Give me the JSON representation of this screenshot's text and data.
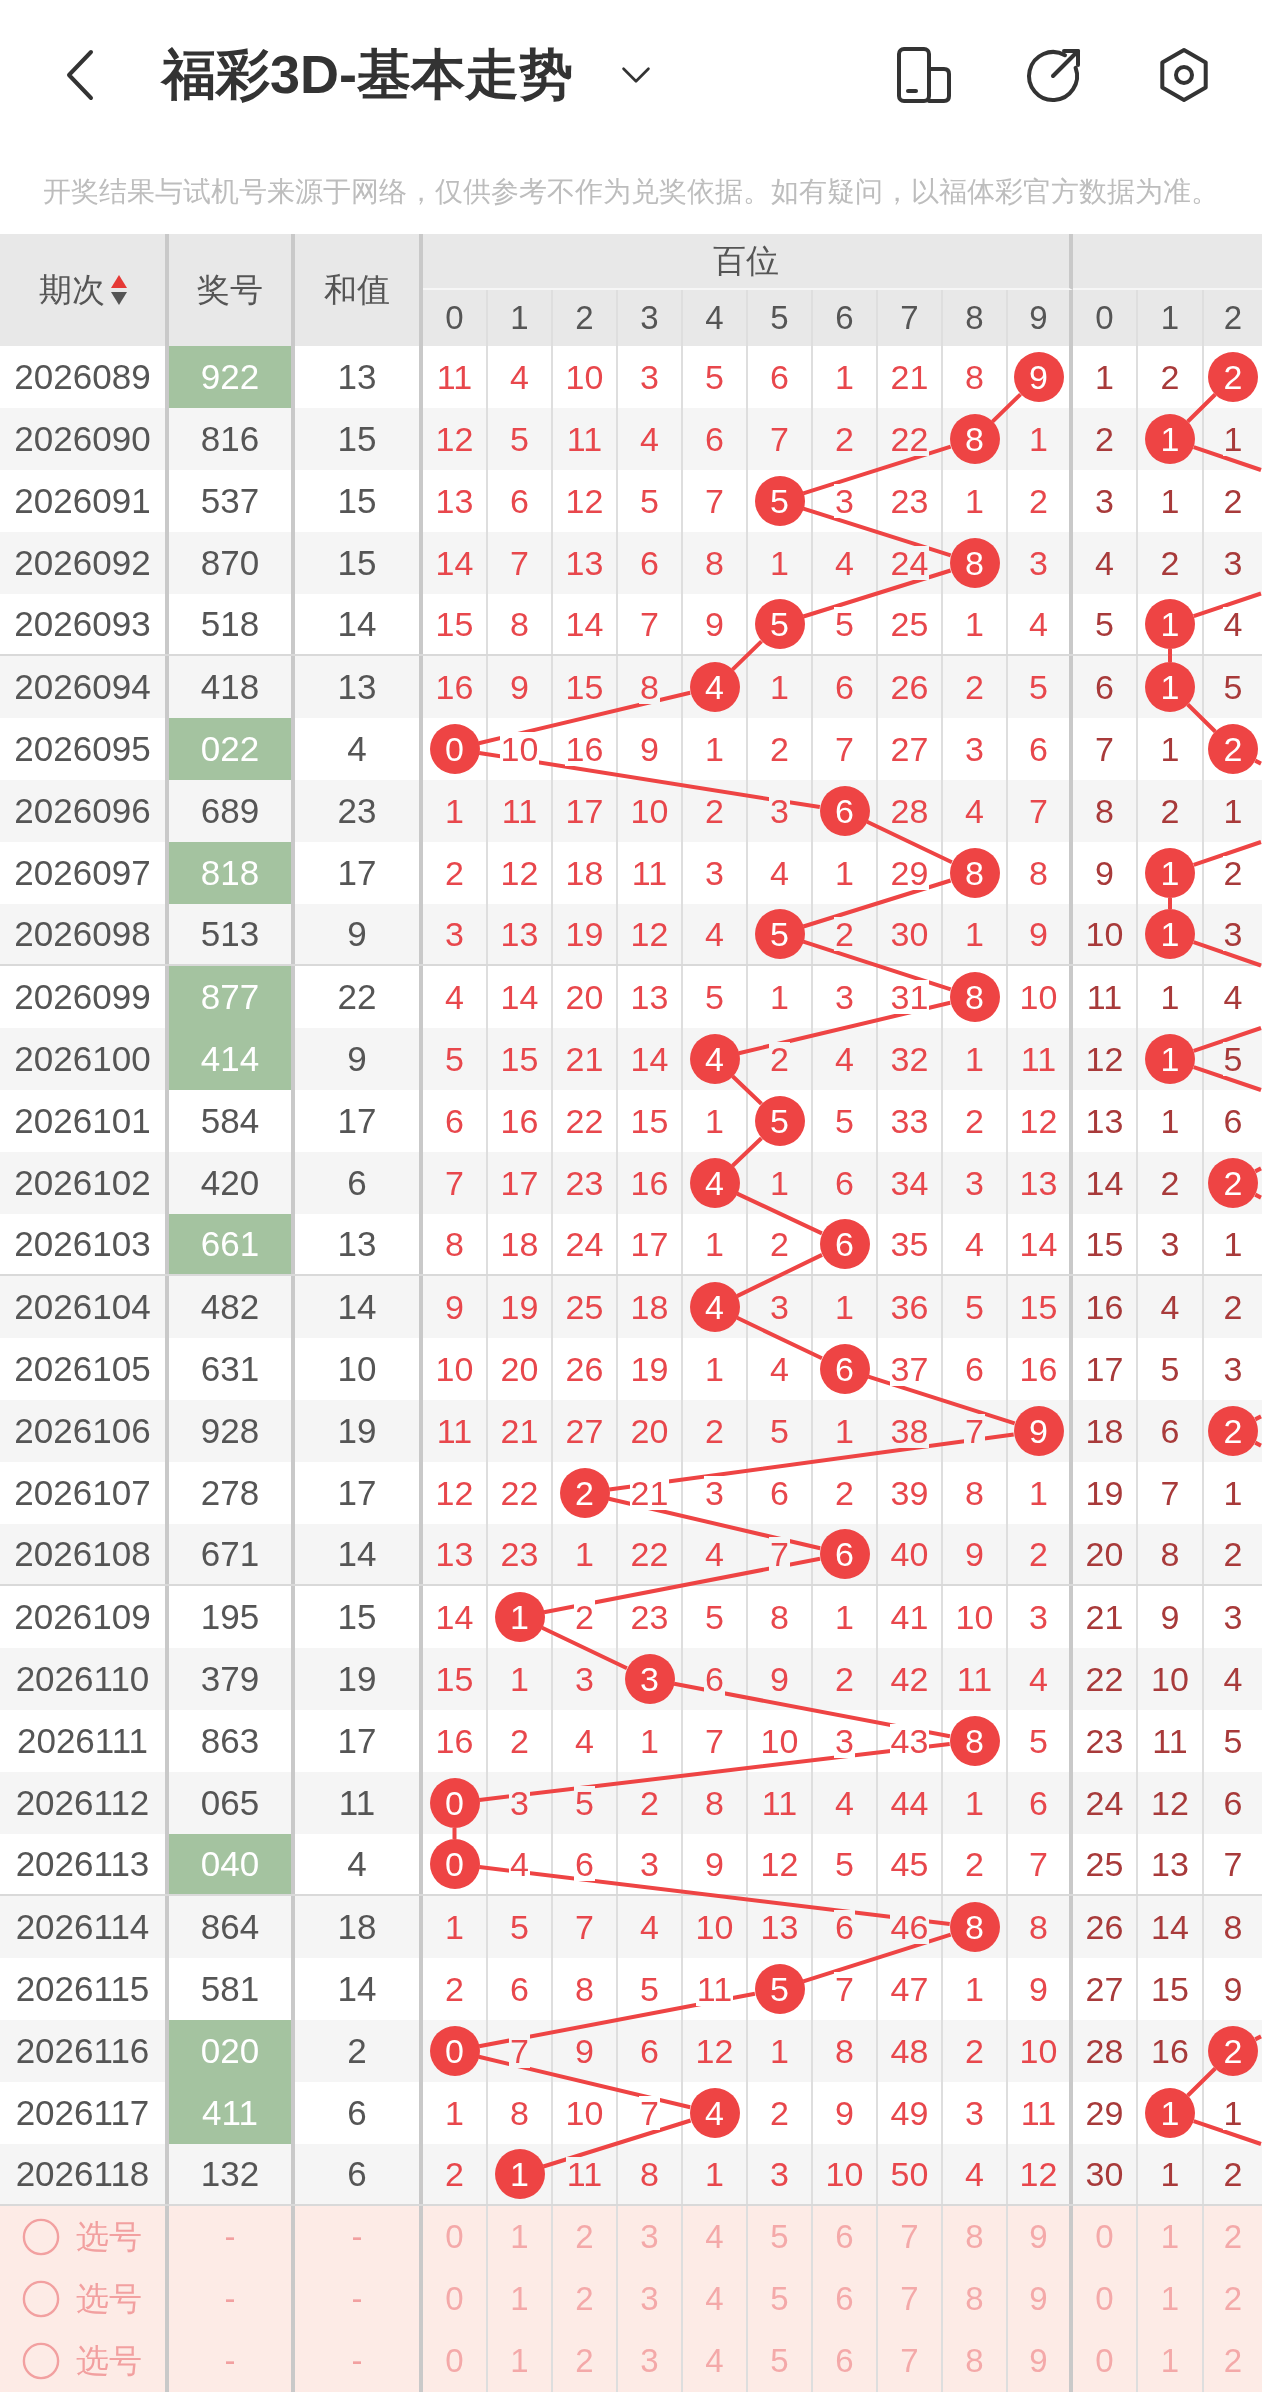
{
  "header": {
    "title": "福彩3D-基本走势"
  },
  "notice": "开奖结果与试机号来源于网络，仅供参考不作为兑奖依据。如有疑问，以福体彩官方数据为准。",
  "table": {
    "columns": [
      {
        "label": "期次",
        "sort_ascending": true
      },
      {
        "label": "奖号"
      },
      {
        "label": "和值"
      }
    ],
    "groups": [
      {
        "label": "百位",
        "digits": [
          "0",
          "1",
          "2",
          "3",
          "4",
          "5",
          "6",
          "7",
          "8",
          "9"
        ]
      },
      {
        "digits": [
          "0",
          "1",
          "2"
        ]
      }
    ],
    "rows": [
      {
        "period": "2026089",
        "number": "922",
        "highlighted": true,
        "sum": "13",
        "hundreds": [
          {
            "text": "11",
            "hit": false
          },
          {
            "text": "4",
            "hit": false
          },
          {
            "text": "10",
            "hit": false
          },
          {
            "text": "3",
            "hit": false
          },
          {
            "text": "5",
            "hit": false
          },
          {
            "text": "6",
            "hit": false
          },
          {
            "text": "1",
            "hit": false
          },
          {
            "text": "21",
            "hit": false
          },
          {
            "text": "8",
            "hit": false
          },
          {
            "text": "9",
            "hit": true
          }
        ],
        "tens": [
          {
            "text": "1",
            "hit": false
          },
          {
            "text": "2",
            "hit": false
          },
          {
            "text": "2",
            "hit": true
          }
        ]
      },
      {
        "period": "2026090",
        "number": "816",
        "highlighted": false,
        "sum": "15",
        "hundreds": [
          {
            "text": "12",
            "hit": false
          },
          {
            "text": "5",
            "hit": false
          },
          {
            "text": "11",
            "hit": false
          },
          {
            "text": "4",
            "hit": false
          },
          {
            "text": "6",
            "hit": false
          },
          {
            "text": "7",
            "hit": false
          },
          {
            "text": "2",
            "hit": false
          },
          {
            "text": "22",
            "hit": false
          },
          {
            "text": "8",
            "hit": true
          },
          {
            "text": "1",
            "hit": false
          }
        ],
        "tens": [
          {
            "text": "2",
            "hit": false
          },
          {
            "text": "1",
            "hit": true
          },
          {
            "text": "1",
            "hit": false
          }
        ]
      },
      {
        "period": "2026091",
        "number": "537",
        "highlighted": false,
        "sum": "15",
        "hundreds": [
          {
            "text": "13",
            "hit": false
          },
          {
            "text": "6",
            "hit": false
          },
          {
            "text": "12",
            "hit": false
          },
          {
            "text": "5",
            "hit": false
          },
          {
            "text": "7",
            "hit": false
          },
          {
            "text": "5",
            "hit": true
          },
          {
            "text": "3",
            "hit": false
          },
          {
            "text": "23",
            "hit": false
          },
          {
            "text": "1",
            "hit": false
          },
          {
            "text": "2",
            "hit": false
          }
        ],
        "tens": [
          {
            "text": "3",
            "hit": false
          },
          {
            "text": "1",
            "hit": false
          },
          {
            "text": "2",
            "hit": false
          }
        ]
      },
      {
        "period": "2026092",
        "number": "870",
        "highlighted": false,
        "sum": "15",
        "hundreds": [
          {
            "text": "14",
            "hit": false
          },
          {
            "text": "7",
            "hit": false
          },
          {
            "text": "13",
            "hit": false
          },
          {
            "text": "6",
            "hit": false
          },
          {
            "text": "8",
            "hit": false
          },
          {
            "text": "1",
            "hit": false
          },
          {
            "text": "4",
            "hit": false
          },
          {
            "text": "24",
            "hit": false
          },
          {
            "text": "8",
            "hit": true
          },
          {
            "text": "3",
            "hit": false
          }
        ],
        "tens": [
          {
            "text": "4",
            "hit": false
          },
          {
            "text": "2",
            "hit": false
          },
          {
            "text": "3",
            "hit": false
          }
        ]
      },
      {
        "period": "2026093",
        "number": "518",
        "highlighted": false,
        "sum": "14",
        "hundreds": [
          {
            "text": "15",
            "hit": false
          },
          {
            "text": "8",
            "hit": false
          },
          {
            "text": "14",
            "hit": false
          },
          {
            "text": "7",
            "hit": false
          },
          {
            "text": "9",
            "hit": false
          },
          {
            "text": "5",
            "hit": true
          },
          {
            "text": "5",
            "hit": false
          },
          {
            "text": "25",
            "hit": false
          },
          {
            "text": "1",
            "hit": false
          },
          {
            "text": "4",
            "hit": false
          }
        ],
        "tens": [
          {
            "text": "5",
            "hit": false
          },
          {
            "text": "1",
            "hit": true
          },
          {
            "text": "4",
            "hit": false
          }
        ]
      },
      {
        "period": "2026094",
        "number": "418",
        "highlighted": false,
        "sum": "13",
        "hundreds": [
          {
            "text": "16",
            "hit": false
          },
          {
            "text": "9",
            "hit": false
          },
          {
            "text": "15",
            "hit": false
          },
          {
            "text": "8",
            "hit": false
          },
          {
            "text": "4",
            "hit": true
          },
          {
            "text": "1",
            "hit": false
          },
          {
            "text": "6",
            "hit": false
          },
          {
            "text": "26",
            "hit": false
          },
          {
            "text": "2",
            "hit": false
          },
          {
            "text": "5",
            "hit": false
          }
        ],
        "tens": [
          {
            "text": "6",
            "hit": false
          },
          {
            "text": "1",
            "hit": true
          },
          {
            "text": "5",
            "hit": false
          }
        ]
      },
      {
        "period": "2026095",
        "number": "022",
        "highlighted": true,
        "sum": "4",
        "hundreds": [
          {
            "text": "0",
            "hit": true
          },
          {
            "text": "10",
            "hit": false
          },
          {
            "text": "16",
            "hit": false
          },
          {
            "text": "9",
            "hit": false
          },
          {
            "text": "1",
            "hit": false
          },
          {
            "text": "2",
            "hit": false
          },
          {
            "text": "7",
            "hit": false
          },
          {
            "text": "27",
            "hit": false
          },
          {
            "text": "3",
            "hit": false
          },
          {
            "text": "6",
            "hit": false
          }
        ],
        "tens": [
          {
            "text": "7",
            "hit": false
          },
          {
            "text": "1",
            "hit": false
          },
          {
            "text": "2",
            "hit": true
          }
        ]
      },
      {
        "period": "2026096",
        "number": "689",
        "highlighted": false,
        "sum": "23",
        "hundreds": [
          {
            "text": "1",
            "hit": false
          },
          {
            "text": "11",
            "hit": false
          },
          {
            "text": "17",
            "hit": false
          },
          {
            "text": "10",
            "hit": false
          },
          {
            "text": "2",
            "hit": false
          },
          {
            "text": "3",
            "hit": false
          },
          {
            "text": "6",
            "hit": true
          },
          {
            "text": "28",
            "hit": false
          },
          {
            "text": "4",
            "hit": false
          },
          {
            "text": "7",
            "hit": false
          }
        ],
        "tens": [
          {
            "text": "8",
            "hit": false
          },
          {
            "text": "2",
            "hit": false
          },
          {
            "text": "1",
            "hit": false
          }
        ]
      },
      {
        "period": "2026097",
        "number": "818",
        "highlighted": true,
        "sum": "17",
        "hundreds": [
          {
            "text": "2",
            "hit": false
          },
          {
            "text": "12",
            "hit": false
          },
          {
            "text": "18",
            "hit": false
          },
          {
            "text": "11",
            "hit": false
          },
          {
            "text": "3",
            "hit": false
          },
          {
            "text": "4",
            "hit": false
          },
          {
            "text": "1",
            "hit": false
          },
          {
            "text": "29",
            "hit": false
          },
          {
            "text": "8",
            "hit": true
          },
          {
            "text": "8",
            "hit": false
          }
        ],
        "tens": [
          {
            "text": "9",
            "hit": false
          },
          {
            "text": "1",
            "hit": true
          },
          {
            "text": "2",
            "hit": false
          }
        ]
      },
      {
        "period": "2026098",
        "number": "513",
        "highlighted": false,
        "sum": "9",
        "hundreds": [
          {
            "text": "3",
            "hit": false
          },
          {
            "text": "13",
            "hit": false
          },
          {
            "text": "19",
            "hit": false
          },
          {
            "text": "12",
            "hit": false
          },
          {
            "text": "4",
            "hit": false
          },
          {
            "text": "5",
            "hit": true
          },
          {
            "text": "2",
            "hit": false
          },
          {
            "text": "30",
            "hit": false
          },
          {
            "text": "1",
            "hit": false
          },
          {
            "text": "9",
            "hit": false
          }
        ],
        "tens": [
          {
            "text": "10",
            "hit": false
          },
          {
            "text": "1",
            "hit": true
          },
          {
            "text": "3",
            "hit": false
          }
        ]
      },
      {
        "period": "2026099",
        "number": "877",
        "highlighted": true,
        "sum": "22",
        "hundreds": [
          {
            "text": "4",
            "hit": false
          },
          {
            "text": "14",
            "hit": false
          },
          {
            "text": "20",
            "hit": false
          },
          {
            "text": "13",
            "hit": false
          },
          {
            "text": "5",
            "hit": false
          },
          {
            "text": "1",
            "hit": false
          },
          {
            "text": "3",
            "hit": false
          },
          {
            "text": "31",
            "hit": false
          },
          {
            "text": "8",
            "hit": true
          },
          {
            "text": "10",
            "hit": false
          }
        ],
        "tens": [
          {
            "text": "11",
            "hit": false
          },
          {
            "text": "1",
            "hit": false
          },
          {
            "text": "4",
            "hit": false
          }
        ]
      },
      {
        "period": "2026100",
        "number": "414",
        "highlighted": true,
        "sum": "9",
        "hundreds": [
          {
            "text": "5",
            "hit": false
          },
          {
            "text": "15",
            "hit": false
          },
          {
            "text": "21",
            "hit": false
          },
          {
            "text": "14",
            "hit": false
          },
          {
            "text": "4",
            "hit": true
          },
          {
            "text": "2",
            "hit": false
          },
          {
            "text": "4",
            "hit": false
          },
          {
            "text": "32",
            "hit": false
          },
          {
            "text": "1",
            "hit": false
          },
          {
            "text": "11",
            "hit": false
          }
        ],
        "tens": [
          {
            "text": "12",
            "hit": false
          },
          {
            "text": "1",
            "hit": true
          },
          {
            "text": "5",
            "hit": false
          }
        ]
      },
      {
        "period": "2026101",
        "number": "584",
        "highlighted": false,
        "sum": "17",
        "hundreds": [
          {
            "text": "6",
            "hit": false
          },
          {
            "text": "16",
            "hit": false
          },
          {
            "text": "22",
            "hit": false
          },
          {
            "text": "15",
            "hit": false
          },
          {
            "text": "1",
            "hit": false
          },
          {
            "text": "5",
            "hit": true
          },
          {
            "text": "5",
            "hit": false
          },
          {
            "text": "33",
            "hit": false
          },
          {
            "text": "2",
            "hit": false
          },
          {
            "text": "12",
            "hit": false
          }
        ],
        "tens": [
          {
            "text": "13",
            "hit": false
          },
          {
            "text": "1",
            "hit": false
          },
          {
            "text": "6",
            "hit": false
          }
        ]
      },
      {
        "period": "2026102",
        "number": "420",
        "highlighted": false,
        "sum": "6",
        "hundreds": [
          {
            "text": "7",
            "hit": false
          },
          {
            "text": "17",
            "hit": false
          },
          {
            "text": "23",
            "hit": false
          },
          {
            "text": "16",
            "hit": false
          },
          {
            "text": "4",
            "hit": true
          },
          {
            "text": "1",
            "hit": false
          },
          {
            "text": "6",
            "hit": false
          },
          {
            "text": "34",
            "hit": false
          },
          {
            "text": "3",
            "hit": false
          },
          {
            "text": "13",
            "hit": false
          }
        ],
        "tens": [
          {
            "text": "14",
            "hit": false
          },
          {
            "text": "2",
            "hit": false
          },
          {
            "text": "2",
            "hit": true
          }
        ]
      },
      {
        "period": "2026103",
        "number": "661",
        "highlighted": true,
        "sum": "13",
        "hundreds": [
          {
            "text": "8",
            "hit": false
          },
          {
            "text": "18",
            "hit": false
          },
          {
            "text": "24",
            "hit": false
          },
          {
            "text": "17",
            "hit": false
          },
          {
            "text": "1",
            "hit": false
          },
          {
            "text": "2",
            "hit": false
          },
          {
            "text": "6",
            "hit": true
          },
          {
            "text": "35",
            "hit": false
          },
          {
            "text": "4",
            "hit": false
          },
          {
            "text": "14",
            "hit": false
          }
        ],
        "tens": [
          {
            "text": "15",
            "hit": false
          },
          {
            "text": "3",
            "hit": false
          },
          {
            "text": "1",
            "hit": false
          }
        ]
      },
      {
        "period": "2026104",
        "number": "482",
        "highlighted": false,
        "sum": "14",
        "hundreds": [
          {
            "text": "9",
            "hit": false
          },
          {
            "text": "19",
            "hit": false
          },
          {
            "text": "25",
            "hit": false
          },
          {
            "text": "18",
            "hit": false
          },
          {
            "text": "4",
            "hit": true
          },
          {
            "text": "3",
            "hit": false
          },
          {
            "text": "1",
            "hit": false
          },
          {
            "text": "36",
            "hit": false
          },
          {
            "text": "5",
            "hit": false
          },
          {
            "text": "15",
            "hit": false
          }
        ],
        "tens": [
          {
            "text": "16",
            "hit": false
          },
          {
            "text": "4",
            "hit": false
          },
          {
            "text": "2",
            "hit": false
          }
        ]
      },
      {
        "period": "2026105",
        "number": "631",
        "highlighted": false,
        "sum": "10",
        "hundreds": [
          {
            "text": "10",
            "hit": false
          },
          {
            "text": "20",
            "hit": false
          },
          {
            "text": "26",
            "hit": false
          },
          {
            "text": "19",
            "hit": false
          },
          {
            "text": "1",
            "hit": false
          },
          {
            "text": "4",
            "hit": false
          },
          {
            "text": "6",
            "hit": true
          },
          {
            "text": "37",
            "hit": false
          },
          {
            "text": "6",
            "hit": false
          },
          {
            "text": "16",
            "hit": false
          }
        ],
        "tens": [
          {
            "text": "17",
            "hit": false
          },
          {
            "text": "5",
            "hit": false
          },
          {
            "text": "3",
            "hit": false
          }
        ]
      },
      {
        "period": "2026106",
        "number": "928",
        "highlighted": false,
        "sum": "19",
        "hundreds": [
          {
            "text": "11",
            "hit": false
          },
          {
            "text": "21",
            "hit": false
          },
          {
            "text": "27",
            "hit": false
          },
          {
            "text": "20",
            "hit": false
          },
          {
            "text": "2",
            "hit": false
          },
          {
            "text": "5",
            "hit": false
          },
          {
            "text": "1",
            "hit": false
          },
          {
            "text": "38",
            "hit": false
          },
          {
            "text": "7",
            "hit": false
          },
          {
            "text": "9",
            "hit": true
          }
        ],
        "tens": [
          {
            "text": "18",
            "hit": false
          },
          {
            "text": "6",
            "hit": false
          },
          {
            "text": "2",
            "hit": true
          }
        ]
      },
      {
        "period": "2026107",
        "number": "278",
        "highlighted": false,
        "sum": "17",
        "hundreds": [
          {
            "text": "12",
            "hit": false
          },
          {
            "text": "22",
            "hit": false
          },
          {
            "text": "2",
            "hit": true
          },
          {
            "text": "21",
            "hit": false
          },
          {
            "text": "3",
            "hit": false
          },
          {
            "text": "6",
            "hit": false
          },
          {
            "text": "2",
            "hit": false
          },
          {
            "text": "39",
            "hit": false
          },
          {
            "text": "8",
            "hit": false
          },
          {
            "text": "1",
            "hit": false
          }
        ],
        "tens": [
          {
            "text": "19",
            "hit": false
          },
          {
            "text": "7",
            "hit": false
          },
          {
            "text": "1",
            "hit": false
          }
        ]
      },
      {
        "period": "2026108",
        "number": "671",
        "highlighted": false,
        "sum": "14",
        "hundreds": [
          {
            "text": "13",
            "hit": false
          },
          {
            "text": "23",
            "hit": false
          },
          {
            "text": "1",
            "hit": false
          },
          {
            "text": "22",
            "hit": false
          },
          {
            "text": "4",
            "hit": false
          },
          {
            "text": "7",
            "hit": false
          },
          {
            "text": "6",
            "hit": true
          },
          {
            "text": "40",
            "hit": false
          },
          {
            "text": "9",
            "hit": false
          },
          {
            "text": "2",
            "hit": false
          }
        ],
        "tens": [
          {
            "text": "20",
            "hit": false
          },
          {
            "text": "8",
            "hit": false
          },
          {
            "text": "2",
            "hit": false
          }
        ]
      },
      {
        "period": "2026109",
        "number": "195",
        "highlighted": false,
        "sum": "15",
        "hundreds": [
          {
            "text": "14",
            "hit": false
          },
          {
            "text": "1",
            "hit": true
          },
          {
            "text": "2",
            "hit": false
          },
          {
            "text": "23",
            "hit": false
          },
          {
            "text": "5",
            "hit": false
          },
          {
            "text": "8",
            "hit": false
          },
          {
            "text": "1",
            "hit": false
          },
          {
            "text": "41",
            "hit": false
          },
          {
            "text": "10",
            "hit": false
          },
          {
            "text": "3",
            "hit": false
          }
        ],
        "tens": [
          {
            "text": "21",
            "hit": false
          },
          {
            "text": "9",
            "hit": false
          },
          {
            "text": "3",
            "hit": false
          }
        ]
      },
      {
        "period": "2026110",
        "number": "379",
        "highlighted": false,
        "sum": "19",
        "hundreds": [
          {
            "text": "15",
            "hit": false
          },
          {
            "text": "1",
            "hit": false
          },
          {
            "text": "3",
            "hit": false
          },
          {
            "text": "3",
            "hit": true
          },
          {
            "text": "6",
            "hit": false
          },
          {
            "text": "9",
            "hit": false
          },
          {
            "text": "2",
            "hit": false
          },
          {
            "text": "42",
            "hit": false
          },
          {
            "text": "11",
            "hit": false
          },
          {
            "text": "4",
            "hit": false
          }
        ],
        "tens": [
          {
            "text": "22",
            "hit": false
          },
          {
            "text": "10",
            "hit": false
          },
          {
            "text": "4",
            "hit": false
          }
        ]
      },
      {
        "period": "2026111",
        "number": "863",
        "highlighted": false,
        "sum": "17",
        "hundreds": [
          {
            "text": "16",
            "hit": false
          },
          {
            "text": "2",
            "hit": false
          },
          {
            "text": "4",
            "hit": false
          },
          {
            "text": "1",
            "hit": false
          },
          {
            "text": "7",
            "hit": false
          },
          {
            "text": "10",
            "hit": false
          },
          {
            "text": "3",
            "hit": false
          },
          {
            "text": "43",
            "hit": false
          },
          {
            "text": "8",
            "hit": true
          },
          {
            "text": "5",
            "hit": false
          }
        ],
        "tens": [
          {
            "text": "23",
            "hit": false
          },
          {
            "text": "11",
            "hit": false
          },
          {
            "text": "5",
            "hit": false
          }
        ]
      },
      {
        "period": "2026112",
        "number": "065",
        "highlighted": false,
        "sum": "11",
        "hundreds": [
          {
            "text": "0",
            "hit": true
          },
          {
            "text": "3",
            "hit": false
          },
          {
            "text": "5",
            "hit": false
          },
          {
            "text": "2",
            "hit": false
          },
          {
            "text": "8",
            "hit": false
          },
          {
            "text": "11",
            "hit": false
          },
          {
            "text": "4",
            "hit": false
          },
          {
            "text": "44",
            "hit": false
          },
          {
            "text": "1",
            "hit": false
          },
          {
            "text": "6",
            "hit": false
          }
        ],
        "tens": [
          {
            "text": "24",
            "hit": false
          },
          {
            "text": "12",
            "hit": false
          },
          {
            "text": "6",
            "hit": false
          }
        ]
      },
      {
        "period": "2026113",
        "number": "040",
        "highlighted": true,
        "sum": "4",
        "hundreds": [
          {
            "text": "0",
            "hit": true
          },
          {
            "text": "4",
            "hit": false
          },
          {
            "text": "6",
            "hit": false
          },
          {
            "text": "3",
            "hit": false
          },
          {
            "text": "9",
            "hit": false
          },
          {
            "text": "12",
            "hit": false
          },
          {
            "text": "5",
            "hit": false
          },
          {
            "text": "45",
            "hit": false
          },
          {
            "text": "2",
            "hit": false
          },
          {
            "text": "7",
            "hit": false
          }
        ],
        "tens": [
          {
            "text": "25",
            "hit": false
          },
          {
            "text": "13",
            "hit": false
          },
          {
            "text": "7",
            "hit": false
          }
        ]
      },
      {
        "period": "2026114",
        "number": "864",
        "highlighted": false,
        "sum": "18",
        "hundreds": [
          {
            "text": "1",
            "hit": false
          },
          {
            "text": "5",
            "hit": false
          },
          {
            "text": "7",
            "hit": false
          },
          {
            "text": "4",
            "hit": false
          },
          {
            "text": "10",
            "hit": false
          },
          {
            "text": "13",
            "hit": false
          },
          {
            "text": "6",
            "hit": false
          },
          {
            "text": "46",
            "hit": false
          },
          {
            "text": "8",
            "hit": true
          },
          {
            "text": "8",
            "hit": false
          }
        ],
        "tens": [
          {
            "text": "26",
            "hit": false
          },
          {
            "text": "14",
            "hit": false
          },
          {
            "text": "8",
            "hit": false
          }
        ]
      },
      {
        "period": "2026115",
        "number": "581",
        "highlighted": false,
        "sum": "14",
        "hundreds": [
          {
            "text": "2",
            "hit": false
          },
          {
            "text": "6",
            "hit": false
          },
          {
            "text": "8",
            "hit": false
          },
          {
            "text": "5",
            "hit": false
          },
          {
            "text": "11",
            "hit": false
          },
          {
            "text": "5",
            "hit": true
          },
          {
            "text": "7",
            "hit": false
          },
          {
            "text": "47",
            "hit": false
          },
          {
            "text": "1",
            "hit": false
          },
          {
            "text": "9",
            "hit": false
          }
        ],
        "tens": [
          {
            "text": "27",
            "hit": false
          },
          {
            "text": "15",
            "hit": false
          },
          {
            "text": "9",
            "hit": false
          }
        ]
      },
      {
        "period": "2026116",
        "number": "020",
        "highlighted": true,
        "sum": "2",
        "hundreds": [
          {
            "text": "0",
            "hit": true
          },
          {
            "text": "7",
            "hit": false
          },
          {
            "text": "9",
            "hit": false
          },
          {
            "text": "6",
            "hit": false
          },
          {
            "text": "12",
            "hit": false
          },
          {
            "text": "1",
            "hit": false
          },
          {
            "text": "8",
            "hit": false
          },
          {
            "text": "48",
            "hit": false
          },
          {
            "text": "2",
            "hit": false
          },
          {
            "text": "10",
            "hit": false
          }
        ],
        "tens": [
          {
            "text": "28",
            "hit": false
          },
          {
            "text": "16",
            "hit": false
          },
          {
            "text": "2",
            "hit": true
          }
        ]
      },
      {
        "period": "2026117",
        "number": "411",
        "highlighted": true,
        "sum": "6",
        "hundreds": [
          {
            "text": "1",
            "hit": false
          },
          {
            "text": "8",
            "hit": false
          },
          {
            "text": "10",
            "hit": false
          },
          {
            "text": "7",
            "hit": false
          },
          {
            "text": "4",
            "hit": true
          },
          {
            "text": "2",
            "hit": false
          },
          {
            "text": "9",
            "hit": false
          },
          {
            "text": "49",
            "hit": false
          },
          {
            "text": "3",
            "hit": false
          },
          {
            "text": "11",
            "hit": false
          }
        ],
        "tens": [
          {
            "text": "29",
            "hit": false
          },
          {
            "text": "1",
            "hit": true
          },
          {
            "text": "1",
            "hit": false
          }
        ]
      },
      {
        "period": "2026118",
        "number": "132",
        "highlighted": false,
        "sum": "6",
        "hundreds": [
          {
            "text": "2",
            "hit": false
          },
          {
            "text": "1",
            "hit": true
          },
          {
            "text": "11",
            "hit": false
          },
          {
            "text": "8",
            "hit": false
          },
          {
            "text": "1",
            "hit": false
          },
          {
            "text": "3",
            "hit": false
          },
          {
            "text": "10",
            "hit": false
          },
          {
            "text": "50",
            "hit": false
          },
          {
            "text": "4",
            "hit": false
          },
          {
            "text": "12",
            "hit": false
          }
        ],
        "tens": [
          {
            "text": "30",
            "hit": false
          },
          {
            "text": "1",
            "hit": false
          },
          {
            "text": "2",
            "hit": false
          }
        ]
      }
    ],
    "pick_rows": [
      {
        "selected": false,
        "label": "选号",
        "number": "-",
        "sum": "-",
        "hundreds": [
          {
            "text": "0",
            "selected": false
          },
          {
            "text": "1",
            "selected": false
          },
          {
            "text": "2",
            "selected": false
          },
          {
            "text": "3",
            "selected": false
          },
          {
            "text": "4",
            "selected": false
          },
          {
            "text": "5",
            "selected": false
          },
          {
            "text": "6",
            "selected": false
          },
          {
            "text": "7",
            "selected": false
          },
          {
            "text": "8",
            "selected": false
          },
          {
            "text": "9",
            "selected": false
          }
        ],
        "tens": [
          {
            "text": "0",
            "selected": false
          },
          {
            "text": "1",
            "selected": false
          },
          {
            "text": "2",
            "selected": false
          }
        ]
      },
      {
        "selected": false,
        "label": "选号",
        "number": "-",
        "sum": "-",
        "hundreds": [
          {
            "text": "0",
            "selected": false
          },
          {
            "text": "1",
            "selected": false
          },
          {
            "text": "2",
            "selected": false
          },
          {
            "text": "3",
            "selected": false
          },
          {
            "text": "4",
            "selected": false
          },
          {
            "text": "5",
            "selected": false
          },
          {
            "text": "6",
            "selected": false
          },
          {
            "text": "7",
            "selected": false
          },
          {
            "text": "8",
            "selected": false
          },
          {
            "text": "9",
            "selected": false
          }
        ],
        "tens": [
          {
            "text": "0",
            "selected": false
          },
          {
            "text": "1",
            "selected": false
          },
          {
            "text": "2",
            "selected": false
          }
        ]
      },
      {
        "selected": false,
        "label": "选号",
        "number": "-",
        "sum": "-",
        "hundreds": [
          {
            "text": "0",
            "selected": false
          },
          {
            "text": "1",
            "selected": false
          },
          {
            "text": "2",
            "selected": false
          },
          {
            "text": "3",
            "selected": false
          },
          {
            "text": "4",
            "selected": false
          },
          {
            "text": "5",
            "selected": false
          },
          {
            "text": "6",
            "selected": false
          },
          {
            "text": "7",
            "selected": false
          },
          {
            "text": "8",
            "selected": false
          },
          {
            "text": "9",
            "selected": false
          }
        ],
        "tens": [
          {
            "text": "0",
            "selected": false
          },
          {
            "text": "1",
            "selected": false
          },
          {
            "text": "2",
            "selected": false
          }
        ]
      }
    ]
  }
}
